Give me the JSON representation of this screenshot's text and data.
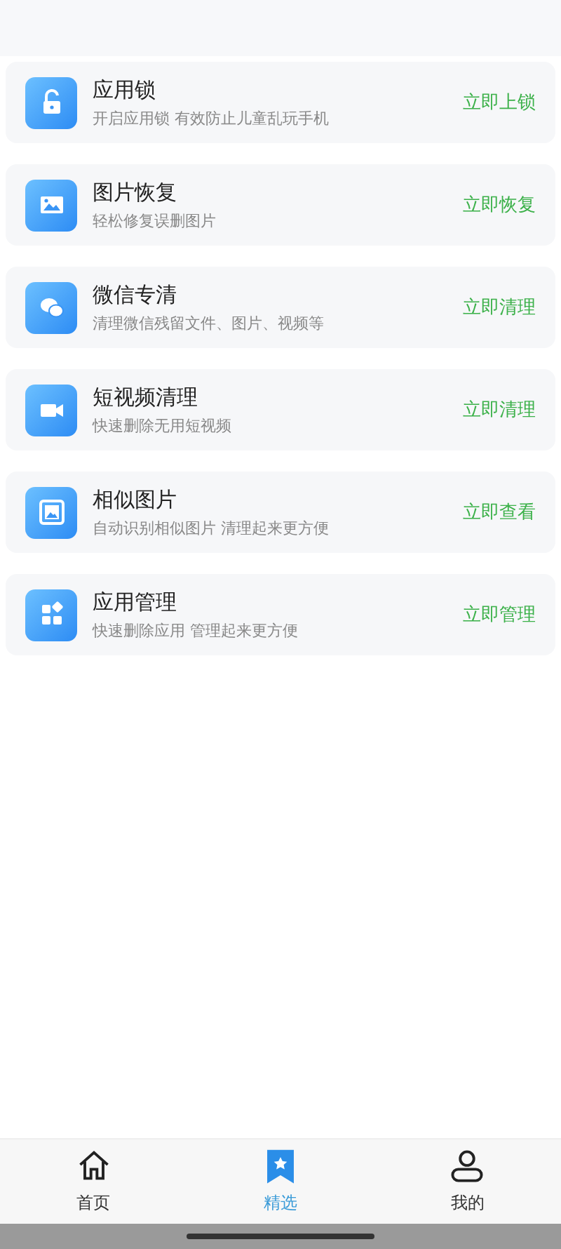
{
  "features": [
    {
      "title": "应用锁",
      "subtitle": "开启应用锁 有效防止儿童乱玩手机",
      "action": "立即上锁"
    },
    {
      "title": "图片恢复",
      "subtitle": "轻松修复误删图片",
      "action": "立即恢复"
    },
    {
      "title": "微信专清",
      "subtitle": "清理微信残留文件、图片、视频等",
      "action": "立即清理"
    },
    {
      "title": "短视频清理",
      "subtitle": "快速删除无用短视频",
      "action": "立即清理"
    },
    {
      "title": "相似图片",
      "subtitle": "自动识别相似图片 清理起来更方便",
      "action": "立即查看"
    },
    {
      "title": "应用管理",
      "subtitle": "快速删除应用 管理起来更方便",
      "action": "立即管理"
    }
  ],
  "tabs": [
    {
      "label": "首页",
      "selected": false
    },
    {
      "label": "精选",
      "selected": true
    },
    {
      "label": "我的",
      "selected": false
    }
  ]
}
